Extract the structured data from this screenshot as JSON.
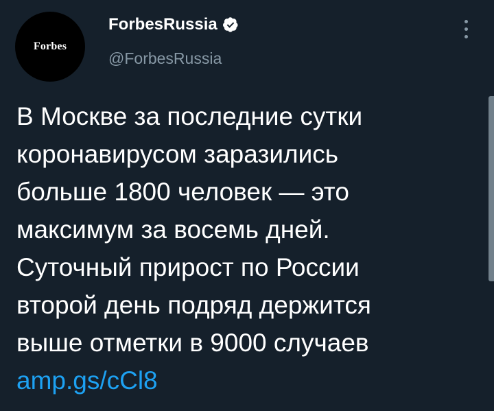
{
  "avatar": {
    "logo_text": "Forbes"
  },
  "author": {
    "display_name": "ForbesRussia",
    "handle": "@ForbesRussia",
    "verified": true
  },
  "tweet": {
    "lines": [
      "В Москве за последние сутки",
      "коронавирусом заразились",
      "больше 1800 человек — это",
      "максимум за восемь дней.",
      "Суточный прирост по России",
      "второй день подряд держится",
      "выше отметки в 9000 случаев"
    ],
    "link": "amp.gs/cCl8"
  },
  "icons": {
    "verified": "verified-badge-icon",
    "more": "more-options-icon"
  },
  "colors": {
    "background": "#15202b",
    "text": "#ffffff",
    "secondary_text": "#8899a6",
    "link": "#1da1f2"
  }
}
